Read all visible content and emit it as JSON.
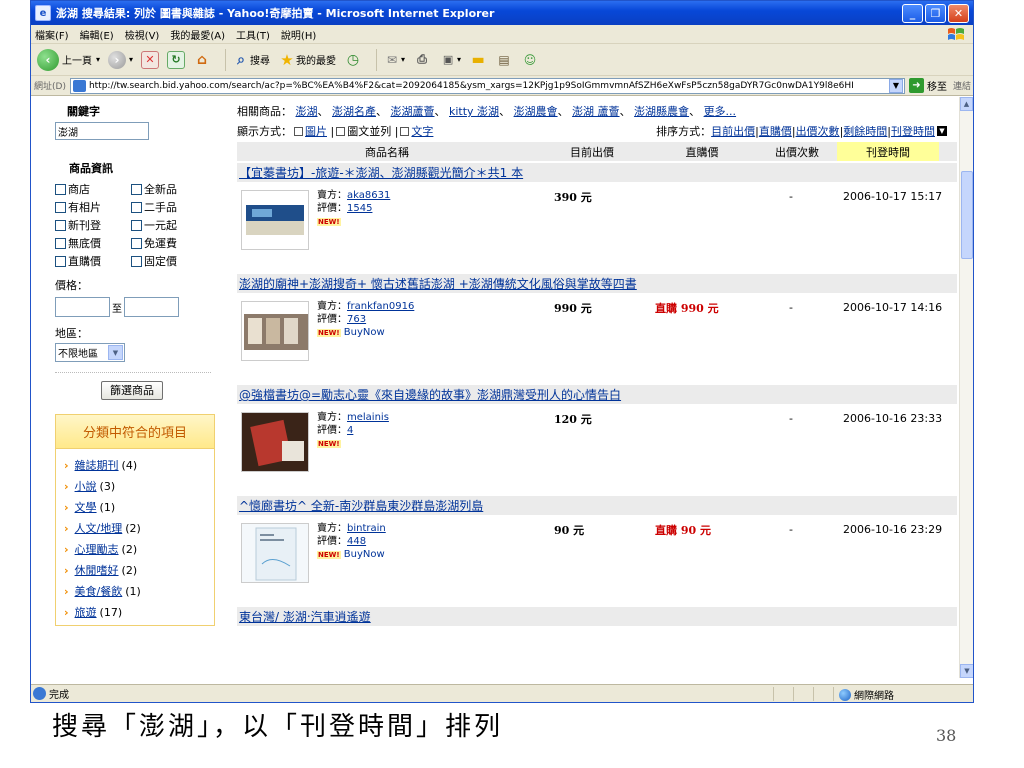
{
  "window": {
    "title": "澎湖 搜尋結果: 列於 圖書與雜誌 - Yahoo!奇摩拍賣 - Microsoft Internet Explorer"
  },
  "menu": [
    "檔案(F)",
    "編輯(E)",
    "檢視(V)",
    "我的最愛(A)",
    "工具(T)",
    "說明(H)"
  ],
  "toolbar": {
    "back_label": "上一頁",
    "search_label": "搜尋",
    "favorites_label": "我的最愛"
  },
  "address": {
    "label": "網址(D)",
    "url": "http://tw.search.bid.yahoo.com/search/ac?p=%BC%EA%B4%F2&cat=2092064185&ysm_xargs=12KPjg1p9SoIGmmvmnAfSZH6eXwFsP5czn58gaDYR7Gc0nwDA1Y9l8e6HI",
    "go_label": "移至",
    "links_label": "連結"
  },
  "sidebar": {
    "keyword_heading": "關鍵字",
    "keyword_value": "澎湖",
    "info_heading": "商品資訊",
    "checkboxes": [
      "商店",
      "全新品",
      "有相片",
      "二手品",
      "新刊登",
      "一元起",
      "無底價",
      "免運費",
      "直購價",
      "固定價"
    ],
    "price_label": "價格：",
    "price_to": "至",
    "region_label": "地區：",
    "region_value": "不限地區",
    "filter_button": "篩選商品",
    "category_heading": "分類中符合的項目",
    "categories": [
      {
        "name": "雜誌期刊",
        "count": "(4)"
      },
      {
        "name": "小說",
        "count": "(3)"
      },
      {
        "name": "文學",
        "count": "(1)"
      },
      {
        "name": "人文/地理",
        "count": "(2)"
      },
      {
        "name": "心理勵志",
        "count": "(2)"
      },
      {
        "name": "休閒嗜好",
        "count": "(2)"
      },
      {
        "name": "美食/餐飲",
        "count": "(1)"
      },
      {
        "name": "旅遊",
        "count": "(17)"
      }
    ]
  },
  "main": {
    "related_label": "相關商品：",
    "related": [
      "澎湖",
      "澎湖名產",
      "澎湖蘆薈",
      "kitty 澎湖",
      "澎湖農會",
      "澎湖 蘆薈",
      "澎湖縣農會"
    ],
    "related_more": "更多...",
    "display_label": "顯示方式：",
    "display_options": [
      "圖片",
      "圖文並列",
      "文字"
    ],
    "sort_label": "排序方式：",
    "sort_options": [
      "目前出價",
      "直購價",
      "出價次數",
      "剩餘時間",
      "刊登時間"
    ],
    "headers": {
      "name": "商品名稱",
      "current": "目前出價",
      "buy": "直購價",
      "bids": "出價次數",
      "time": "刊登時間"
    },
    "seller_label": "賣方：",
    "rating_label": "評價：",
    "new_badge": "NEW!",
    "items": [
      {
        "title": "【宜蓁書坊】-旅遊-＊澎湖、澎湖縣觀光簡介＊共1 本",
        "seller": "aka8631",
        "rating": "1545",
        "buynow": "",
        "price": "390 元",
        "buy_price": "",
        "bids": "-",
        "time": "2006-10-17 15:17"
      },
      {
        "title": "澎湖的廟神+澎湖搜奇+ 懷古述舊話澎湖 +澎湖傳統文化風俗與掌故等四書",
        "seller": "frankfan0916",
        "rating": "763",
        "buynow": "BuyNow",
        "price": "990 元",
        "buy_price": "直購 990 元",
        "bids": "-",
        "time": "2006-10-17 14:16"
      },
      {
        "title": "@強檔書坊@=勵志心靈《來自邊緣的故事》澎湖鼎灣受刑人的心情告白",
        "seller": "melainis",
        "rating": "4",
        "buynow": "",
        "price": "120 元",
        "buy_price": "",
        "bids": "-",
        "time": "2006-10-16 23:33"
      },
      {
        "title": "^憶廊書坊^ 全新-南沙群島東沙群島澎湖列島",
        "seller": "bintrain",
        "rating": "448",
        "buynow": "BuyNow",
        "price": "90 元",
        "buy_price": "直購 90 元",
        "bids": "-",
        "time": "2006-10-16 23:29"
      },
      {
        "title": "東台灣/ 澎湖‧汽車逍遙遊"
      }
    ]
  },
  "status": {
    "text": "完成",
    "zone": "網際網路"
  },
  "slide": {
    "caption": "搜尋「澎湖」，以「刊登時間」排列",
    "page_number": "38"
  }
}
